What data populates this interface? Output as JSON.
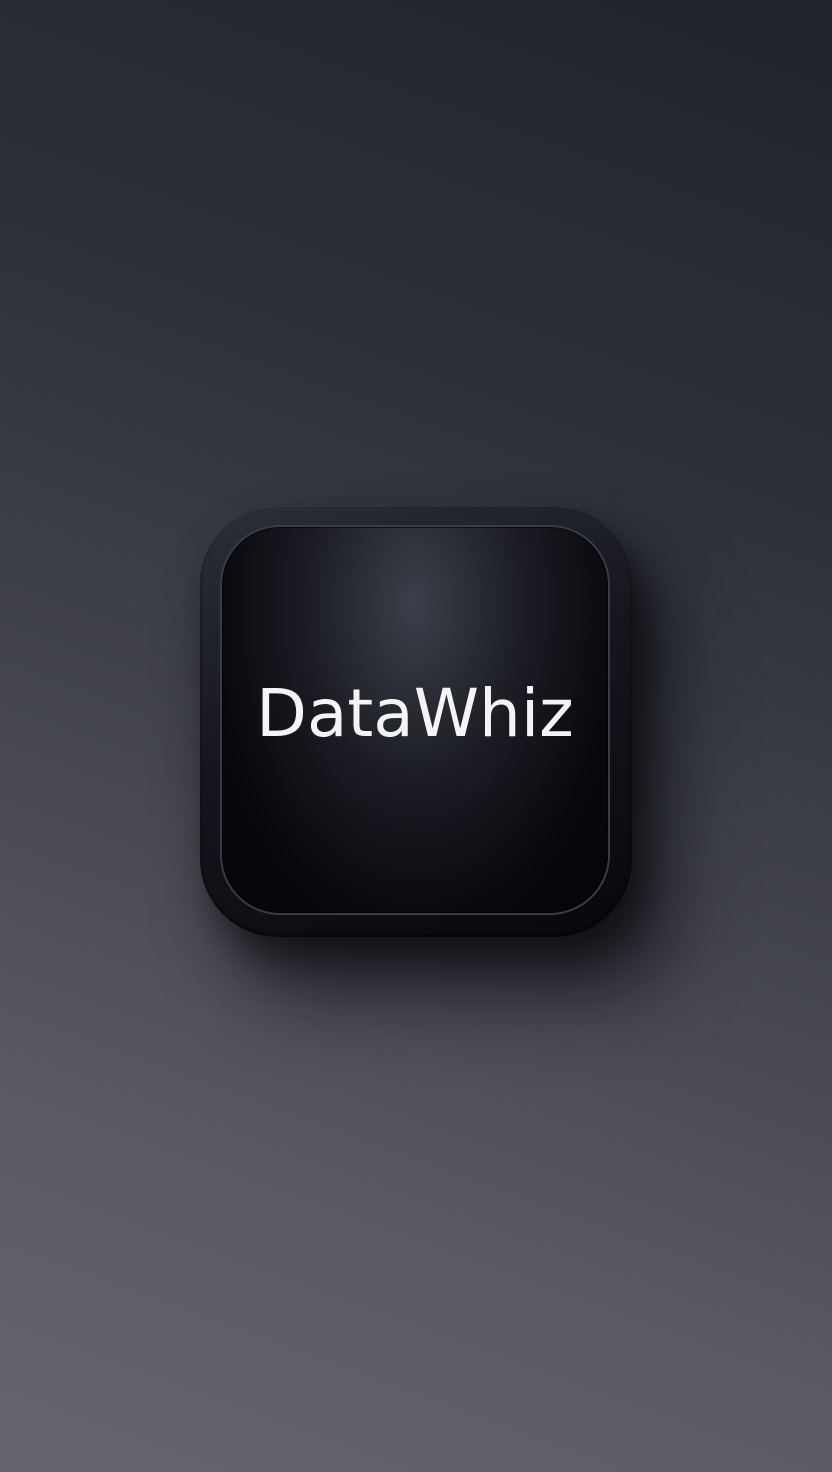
{
  "app_icon": {
    "label": "DataWhiz",
    "icon_name": "datawhiz-app-icon"
  },
  "colors": {
    "background_top": "#1f232b",
    "background_bottom": "#66656f",
    "icon_body": "#08080c",
    "label_text": "#f4f4f6"
  }
}
